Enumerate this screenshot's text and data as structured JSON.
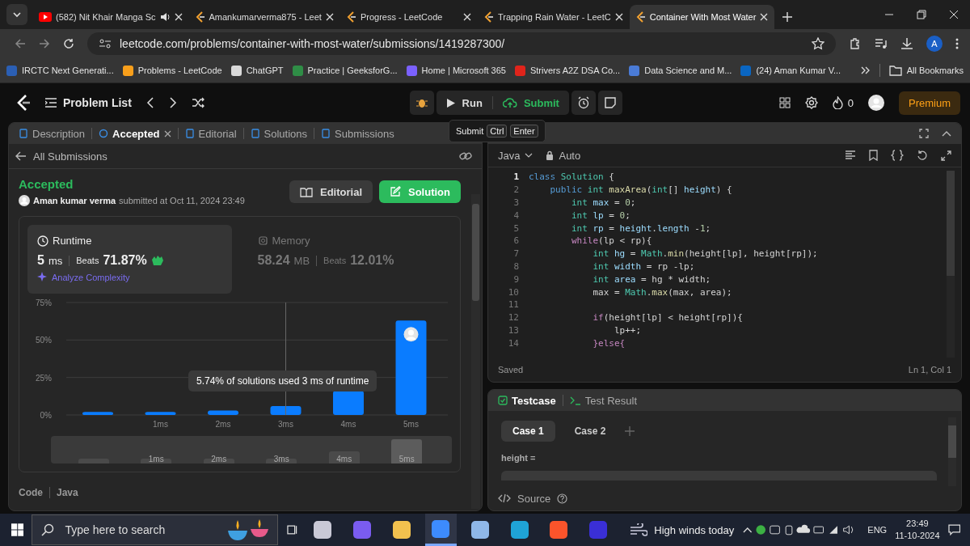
{
  "browser": {
    "tabs": [
      {
        "title": "(582) Nit Khair Manga Sc",
        "kind": "youtube",
        "audio": true,
        "selected": false
      },
      {
        "title": "Amankumarverma875 - Leet",
        "kind": "leetcode",
        "audio": false,
        "selected": false
      },
      {
        "title": "Progress - LeetCode",
        "kind": "leetcode",
        "audio": false,
        "selected": false
      },
      {
        "title": "Trapping Rain Water - LeetC",
        "kind": "leetcode",
        "audio": false,
        "selected": false
      },
      {
        "title": "Container With Most Water",
        "kind": "leetcode",
        "audio": false,
        "selected": true
      }
    ],
    "url": "leetcode.com/problems/container-with-most-water/submissions/1419287300/",
    "profile_initial": "A"
  },
  "bookmarks": {
    "items": [
      {
        "label": "IRCTC Next Generati...",
        "color": "#2b5fb4"
      },
      {
        "label": "Problems - LeetCode",
        "color": "#f89f1b"
      },
      {
        "label": "ChatGPT",
        "color": "#d9d9d9"
      },
      {
        "label": "Practice | GeeksforG...",
        "color": "#2f8d46"
      },
      {
        "label": "Home | Microsoft 365",
        "color": "#7b61ff"
      },
      {
        "label": "Strivers A2Z DSA Co...",
        "color": "#e0241b"
      },
      {
        "label": "Data Science and M...",
        "color": "#4a7bd6"
      },
      {
        "label": "(24) Aman Kumar V...",
        "color": "#0a66c2"
      }
    ],
    "all_label": "All Bookmarks"
  },
  "header": {
    "problem_list": "Problem List",
    "run": "Run",
    "submit": "Submit",
    "streak": "0",
    "premium": "Premium"
  },
  "shortcut_tooltip": {
    "label": "Submit",
    "keys": [
      "Ctrl",
      "Enter"
    ]
  },
  "panel_tabs": [
    {
      "label": "Description",
      "selected": false,
      "closable": false
    },
    {
      "label": "Accepted",
      "selected": true,
      "closable": true
    },
    {
      "label": "Editorial",
      "selected": false,
      "closable": false
    },
    {
      "label": "Solutions",
      "selected": false,
      "closable": false
    },
    {
      "label": "Submissions",
      "selected": false,
      "closable": false
    }
  ],
  "submission": {
    "back_label": "All Submissions",
    "status": "Accepted",
    "user": "Aman kumar verma",
    "submitted": "submitted at Oct 11, 2024 23:49",
    "buttons": [
      {
        "label": "Editorial",
        "kind": "secondary"
      },
      {
        "label": "Solution",
        "kind": "primary"
      }
    ],
    "metrics": [
      {
        "label": "Runtime",
        "kind": "runtime",
        "value": "5",
        "unit": "ms",
        "beats_label": "Beats",
        "beats": "71.87%",
        "selected": true
      },
      {
        "label": "Memory",
        "kind": "memory",
        "value": "58.24",
        "unit": "MB",
        "beats_label": "Beats",
        "beats": "12.01%",
        "selected": false
      }
    ],
    "analyze": "Analyze Complexity",
    "chart": {
      "chart_data": {
        "type": "bar",
        "categories": [
          null,
          "1ms",
          "2ms",
          "3ms",
          "4ms",
          "5ms"
        ],
        "values": [
          2,
          2,
          3,
          6,
          16,
          63
        ],
        "ylim": [
          0,
          75
        ],
        "yticks": [
          {
            "value": 0,
            "label": "0%"
          },
          {
            "value": 25,
            "label": "25%"
          },
          {
            "value": 50,
            "label": "50%"
          },
          {
            "value": 75,
            "label": "75%"
          }
        ],
        "annotations": [
          "5.74% of solutions used 3 ms of runtime"
        ]
      },
      "navigator": [
        {
          "selected": false
        },
        {
          "label": "1ms",
          "selected": false
        },
        {
          "label": "2ms",
          "selected": false
        },
        {
          "label": "3ms",
          "selected": false
        },
        {
          "label": "4ms",
          "selected": false
        },
        {
          "label": "5ms",
          "selected": true
        }
      ]
    },
    "code_label": "Code",
    "code_language": "Java"
  },
  "editor": {
    "language": "Java",
    "mode": "Auto",
    "status": "Saved",
    "cursor": "Ln 1, Col 1",
    "lines": [
      {
        "number": "1",
        "current": true,
        "code": [
          {
            "text": "class",
            "kind": "kw"
          },
          {
            "text": " Solution",
            "kind": "cls"
          },
          {
            "text": " {"
          }
        ]
      },
      {
        "number": "2",
        "current": false,
        "code": [
          {
            "text": "    public",
            "kind": "kw"
          },
          {
            "text": " int",
            "kind": "type"
          },
          {
            "text": " maxArea",
            "kind": "fn"
          },
          {
            "text": "("
          },
          {
            "text": "int",
            "kind": "type"
          },
          {
            "text": "[] "
          },
          {
            "text": "height",
            "kind": "var"
          },
          {
            "text": ") {"
          }
        ]
      },
      {
        "number": "3",
        "current": false,
        "code": [
          {
            "text": "        int",
            "kind": "type"
          },
          {
            "text": " max",
            "kind": "var"
          },
          {
            "text": " = "
          },
          {
            "text": "0",
            "kind": "num"
          },
          {
            "text": ";"
          }
        ]
      },
      {
        "number": "4",
        "current": false,
        "code": [
          {
            "text": "        int",
            "kind": "type"
          },
          {
            "text": " lp",
            "kind": "var"
          },
          {
            "text": " = "
          },
          {
            "text": "0",
            "kind": "num"
          },
          {
            "text": ";"
          }
        ]
      },
      {
        "number": "5",
        "current": false,
        "code": [
          {
            "text": "        int",
            "kind": "type"
          },
          {
            "text": " rp",
            "kind": "var"
          },
          {
            "text": " = "
          },
          {
            "text": "height",
            "kind": "var"
          },
          {
            "text": "."
          },
          {
            "text": "length",
            "kind": "var"
          },
          {
            "text": " -"
          },
          {
            "text": "1",
            "kind": "num"
          },
          {
            "text": ";"
          }
        ]
      },
      {
        "number": "6",
        "current": false,
        "code": [
          {
            "text": "        while",
            "kind": "ctrl"
          },
          {
            "text": "(lp < rp){"
          }
        ]
      },
      {
        "number": "7",
        "current": false,
        "code": [
          {
            "text": "            int",
            "kind": "type"
          },
          {
            "text": " hg",
            "kind": "var"
          },
          {
            "text": " = "
          },
          {
            "text": "Math",
            "kind": "cls"
          },
          {
            "text": "."
          },
          {
            "text": "min",
            "kind": "fn"
          },
          {
            "text": "(height[lp], height[rp]);"
          }
        ]
      },
      {
        "number": "8",
        "current": false,
        "code": [
          {
            "text": "            int",
            "kind": "type"
          },
          {
            "text": " width",
            "kind": "var"
          },
          {
            "text": " = rp -lp;"
          }
        ]
      },
      {
        "number": "9",
        "current": false,
        "code": [
          {
            "text": "            int",
            "kind": "type"
          },
          {
            "text": " area",
            "kind": "var"
          },
          {
            "text": " = hg * width;"
          }
        ]
      },
      {
        "number": "10",
        "current": false,
        "code": [
          {
            "text": "            max = "
          },
          {
            "text": "Math",
            "kind": "cls"
          },
          {
            "text": "."
          },
          {
            "text": "max",
            "kind": "fn"
          },
          {
            "text": "(max, area);"
          }
        ]
      },
      {
        "number": "11",
        "current": false
      },
      {
        "number": "12",
        "current": false,
        "code": [
          {
            "text": "            if",
            "kind": "ctrl"
          },
          {
            "text": "(height[lp] < height[rp]){"
          }
        ]
      },
      {
        "number": "13",
        "current": false,
        "code": [
          {
            "text": "                lp++;"
          }
        ]
      },
      {
        "number": "14",
        "current": false,
        "code": [
          {
            "text": "            }else{",
            "kind": "ctrl"
          }
        ]
      }
    ]
  },
  "testcase": {
    "tabs": [
      {
        "label": "Testcase",
        "kind": "testcase",
        "selected": true
      },
      {
        "label": "Test Result",
        "kind": "result",
        "selected": false
      }
    ],
    "cases": [
      {
        "label": "Case 1",
        "selected": true
      },
      {
        "label": "Case 2",
        "selected": false
      }
    ],
    "param": "height =",
    "source": "Source"
  },
  "taskbar": {
    "search_placeholder": "Type here to search",
    "apps": [
      {
        "color": "#c9c9d6",
        "selected": false
      },
      {
        "color": "#7a5cf0",
        "selected": false
      },
      {
        "color": "#f2c14e",
        "selected": false
      },
      {
        "color": "#3d8bfd",
        "selected": true
      },
      {
        "color": "#8fb7e8",
        "selected": false
      },
      {
        "color": "#1fa3d6",
        "selected": false
      },
      {
        "color": "#fb542b",
        "selected": false
      },
      {
        "color": "#3a2fd6",
        "selected": false
      }
    ],
    "weather": "High winds today",
    "language": "ENG",
    "time": "23:49",
    "date": "11-10-2024"
  }
}
